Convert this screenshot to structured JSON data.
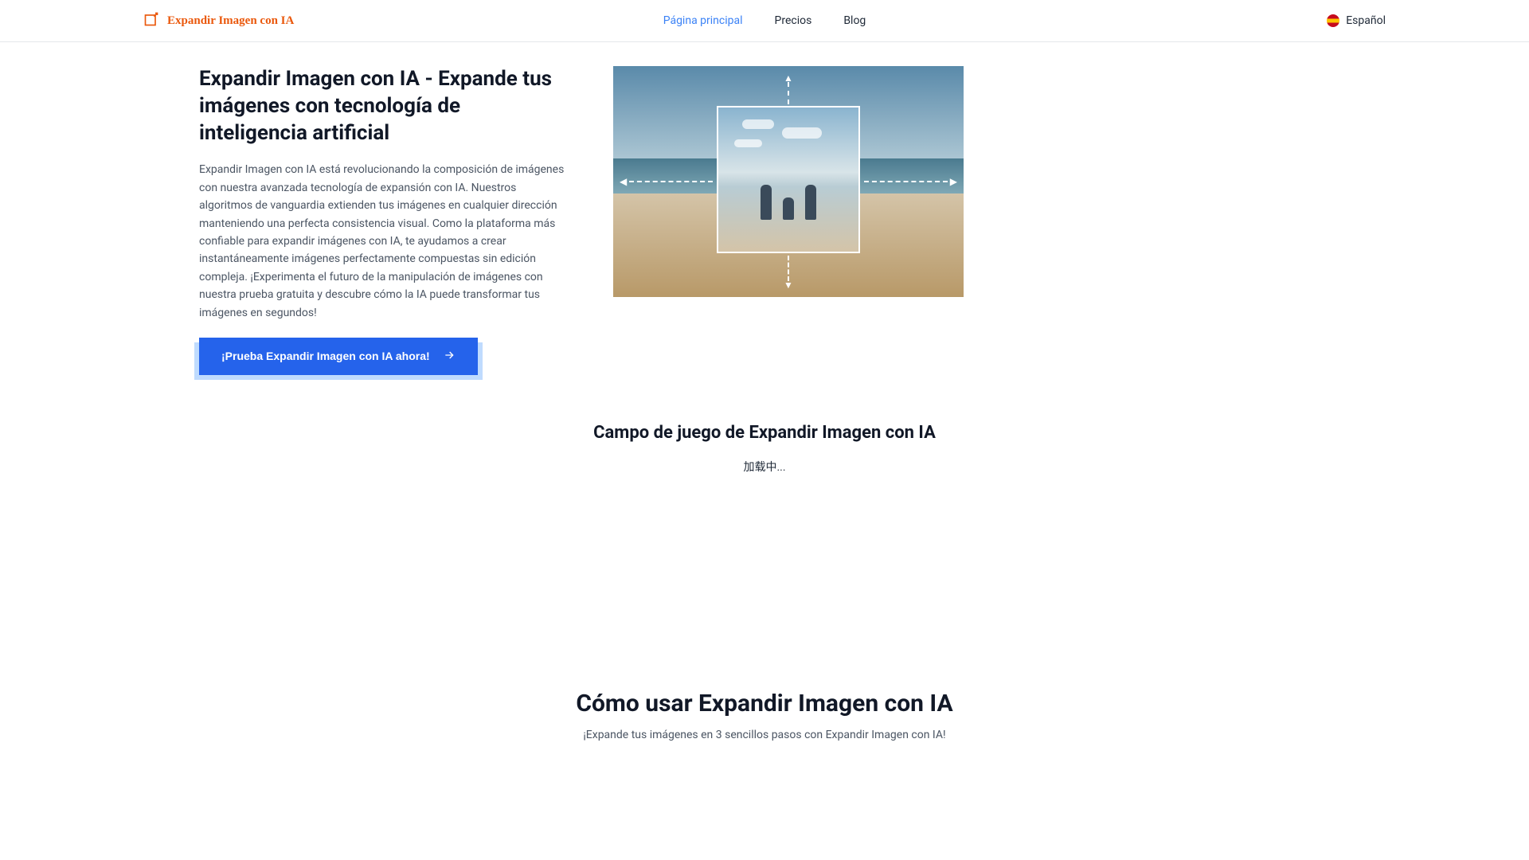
{
  "header": {
    "brand": "Expandir Imagen con IA",
    "nav": {
      "home": "Página principal",
      "pricing": "Precios",
      "blog": "Blog"
    },
    "language": "Español"
  },
  "hero": {
    "title": "Expandir Imagen con IA - Expande tus imágenes con tecnología de inteligencia artificial",
    "description": "Expandir Imagen con IA está revolucionando la composición de imágenes con nuestra avanzada tecnología de expansión con IA. Nuestros algoritmos de vanguardia extienden tus imágenes en cualquier dirección manteniendo una perfecta consistencia visual. Como la plataforma más confiable para expandir imágenes con IA, te ayudamos a crear instantáneamente imágenes perfectamente compuestas sin edición compleja. ¡Experimenta el futuro de la manipulación de imágenes con nuestra prueba gratuita y descubre cómo la IA puede transformar tus imágenes en segundos!",
    "cta": "¡Prueba Expandir Imagen con IA ahora!"
  },
  "playground": {
    "title": "Campo de juego de Expandir Imagen con IA",
    "loading": "加载中..."
  },
  "howto": {
    "title": "Cómo usar Expandir Imagen con IA",
    "subtitle": "¡Expande tus imágenes en 3 sencillos pasos con Expandir Imagen con IA!"
  }
}
